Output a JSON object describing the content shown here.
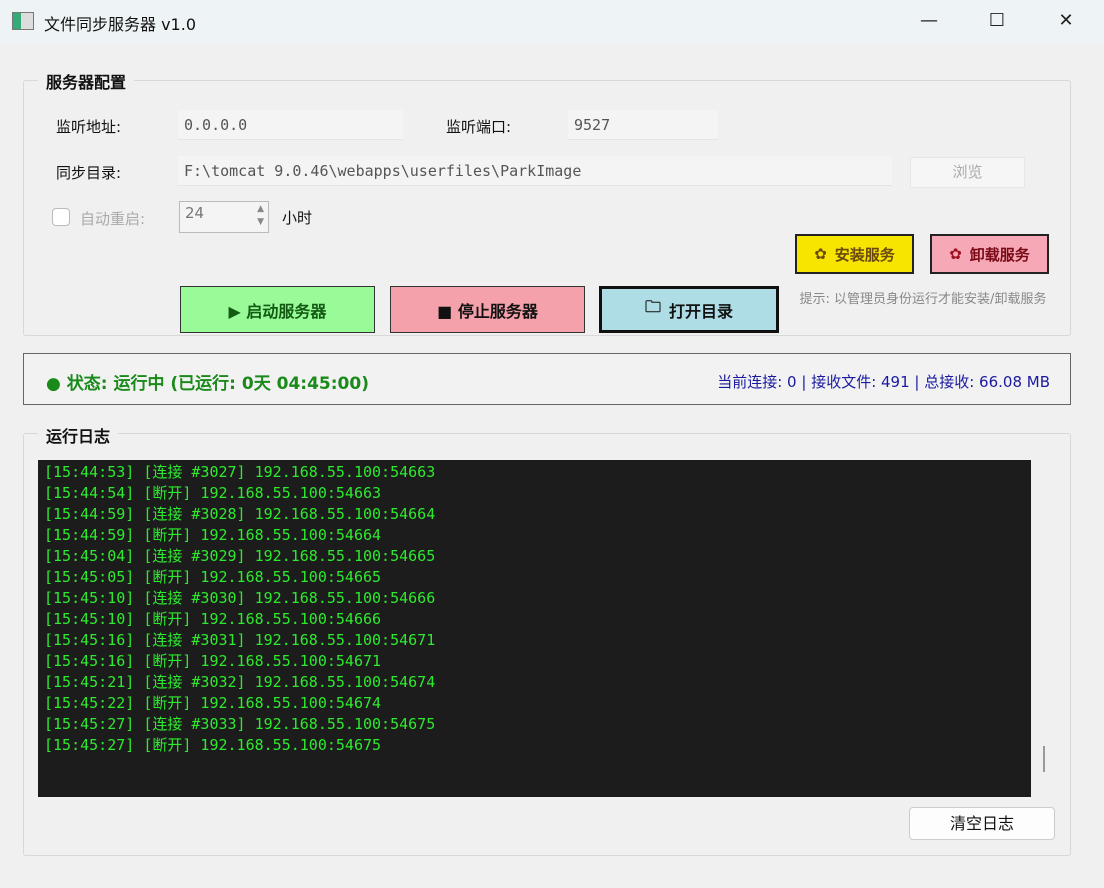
{
  "window": {
    "title": "文件同步服务器 v1.0",
    "minimize": "—",
    "maximize": "☐",
    "close": "✕"
  },
  "config": {
    "title": "服务器配置",
    "addr_label": "监听地址:",
    "addr_value": "0.0.0.0",
    "port_label": "监听端口:",
    "port_value": "9527",
    "dir_label": "同步目录:",
    "dir_value": "F:\\tomcat 9.0.46\\webapps\\userfiles\\ParkImage",
    "browse": "浏览",
    "auto_restart_label": "自动重启:",
    "auto_restart_value": "24",
    "hours_unit": "小时",
    "auto_restart_checked": false
  },
  "buttons": {
    "install": "安装服务",
    "uninstall": "卸载服务",
    "start": "▶ 启动服务器",
    "stop": "■ 停止服务器",
    "open_dir": "打开目录",
    "hint": "提示: 以管理员身份运行才能安装/卸载服务"
  },
  "status": {
    "text": "● 状态: 运行中 (已运行: 0天 04:45:00)",
    "stats": "当前连接: 0 | 接收文件: 491 | 总接收: 66.08 MB",
    "color": "#1a8a1a",
    "stats_color": "#1a1aa0"
  },
  "log": {
    "title": "运行日志",
    "clear": "清空日志",
    "lines": [
      "[15:44:53] [连接 #3027] 192.168.55.100:54663",
      "[15:44:54] [断开] 192.168.55.100:54663",
      "[15:44:59] [连接 #3028] 192.168.55.100:54664",
      "[15:44:59] [断开] 192.168.55.100:54664",
      "[15:45:04] [连接 #3029] 192.168.55.100:54665",
      "[15:45:05] [断开] 192.168.55.100:54665",
      "[15:45:10] [连接 #3030] 192.168.55.100:54666",
      "[15:45:10] [断开] 192.168.55.100:54666",
      "[15:45:16] [连接 #3031] 192.168.55.100:54671",
      "[15:45:16] [断开] 192.168.55.100:54671",
      "[15:45:21] [连接 #3032] 192.168.55.100:54674",
      "[15:45:22] [断开] 192.168.55.100:54674",
      "[15:45:27] [连接 #3033] 192.168.55.100:54675",
      "[15:45:27] [断开] 192.168.55.100:54675"
    ]
  }
}
